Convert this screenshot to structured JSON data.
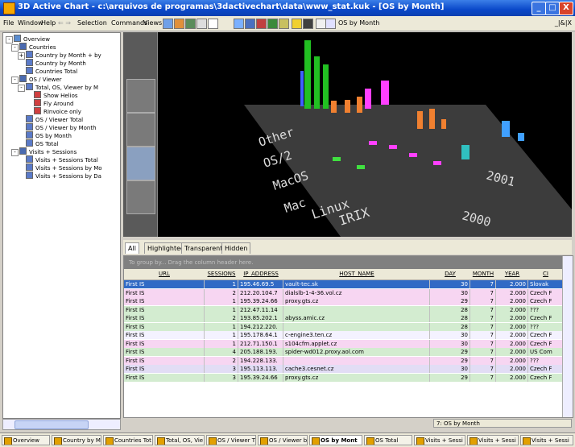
{
  "window": {
    "title": "3D Active Chart - c:\\arquivos de programas\\3dactivechart\\data\\www_stat.kuk - [OS by Month]",
    "minimize": "_",
    "maximize": "□",
    "close": "X"
  },
  "menu": {
    "items": [
      "File",
      "Window",
      "Help",
      "Selection",
      "Commands",
      "Views"
    ],
    "view_name": "OS by Month",
    "mdi_controls": "_|&|X"
  },
  "tree": [
    {
      "label": "Overview",
      "level": 0
    },
    {
      "label": "Countries",
      "level": 1
    },
    {
      "label": "Country by Month + by",
      "level": 2
    },
    {
      "label": "Country by Month",
      "level": 2
    },
    {
      "label": "Countries Total",
      "level": 2
    },
    {
      "label": "OS / Viewer",
      "level": 1
    },
    {
      "label": "Total, OS, Viewer by M",
      "level": 2
    },
    {
      "label": "Show Helios",
      "level": 3
    },
    {
      "label": "Fly Around",
      "level": 3
    },
    {
      "label": "RInvoice only",
      "level": 3
    },
    {
      "label": "OS / Viewer Total",
      "level": 2
    },
    {
      "label": "OS / Viewer by Month",
      "level": 2
    },
    {
      "label": "OS by Month",
      "level": 2
    },
    {
      "label": "OS Total",
      "level": 2
    },
    {
      "label": "Visits + Sessions",
      "level": 1
    },
    {
      "label": "Visits + Sessions Total",
      "level": 2
    },
    {
      "label": "Visits + Sessions by Mo",
      "level": 2
    },
    {
      "label": "Visits + Sessions by Da",
      "level": 2
    }
  ],
  "chart": {
    "os_labels": [
      "Other",
      "OS/2",
      "MacOS",
      "Mac",
      "Linux",
      "IRIX"
    ],
    "year_labels": [
      "2001",
      "2000"
    ],
    "side_tools": [
      "zoom",
      "pan",
      "rotate",
      "fit"
    ]
  },
  "tabs": [
    "All",
    "Highlighted",
    "Transparent",
    "Hidden"
  ],
  "grid": {
    "group_hint": "To group by... Drag the column header here.",
    "columns": [
      "URL",
      "SESSIONS",
      "IP_ADDRESS",
      "HOST_NAME",
      "DAY",
      "MONTH",
      "YEAR",
      "CI"
    ],
    "rows": [
      {
        "url": "First IS",
        "sessions": "1",
        "ip": "195.46.69.5",
        "host": "vault-tec.sk",
        "day": "30",
        "month": "7",
        "year": "2.000",
        "ci": "Slovak",
        "color": "#316ac5"
      },
      {
        "url": "First IS",
        "sessions": "2",
        "ip": "212.20.104.7",
        "host": "dialslb-1-4-36.vol.cz",
        "day": "30",
        "month": "7",
        "year": "2.000",
        "ci": "Czech F",
        "color": "#f7d6f2"
      },
      {
        "url": "First IS",
        "sessions": "1",
        "ip": "195.39.24.66",
        "host": "proxy.gts.cz",
        "day": "29",
        "month": "7",
        "year": "2.000",
        "ci": "Czech F",
        "color": "#f7d6f2"
      },
      {
        "url": "First IS",
        "sessions": "1",
        "ip": "212.47.11.14",
        "host": "",
        "day": "28",
        "month": "7",
        "year": "2.000",
        "ci": "???",
        "color": "#d3ecd0"
      },
      {
        "url": "First IS",
        "sessions": "2",
        "ip": "193.85.202.1",
        "host": "abyss.amic.cz",
        "day": "28",
        "month": "7",
        "year": "2.000",
        "ci": "Czech F",
        "color": "#d3ecd0"
      },
      {
        "url": "First IS",
        "sessions": "1",
        "ip": "194.212.220.",
        "host": "",
        "day": "28",
        "month": "7",
        "year": "2.000",
        "ci": "???",
        "color": "#d3ecd0"
      },
      {
        "url": "First IS",
        "sessions": "1",
        "ip": "195.178.64.1",
        "host": "c-engine3.ten.cz",
        "day": "30",
        "month": "7",
        "year": "2.000",
        "ci": "Czech F",
        "color": "#f4f2ff"
      },
      {
        "url": "First IS",
        "sessions": "1",
        "ip": "212.71.150.1",
        "host": "s104cfm.applet.cz",
        "day": "30",
        "month": "7",
        "year": "2.000",
        "ci": "Czech F",
        "color": "#f7d6f2"
      },
      {
        "url": "First IS",
        "sessions": "4",
        "ip": "205.188.193.",
        "host": "spider-wd012.proxy.aol.com",
        "day": "29",
        "month": "7",
        "year": "2.000",
        "ci": "US Com",
        "color": "#d3ecd0"
      },
      {
        "url": "First IS",
        "sessions": "2",
        "ip": "194.228.133.",
        "host": "",
        "day": "29",
        "month": "7",
        "year": "2.000",
        "ci": "???",
        "color": "#f7d6f2"
      },
      {
        "url": "First IS",
        "sessions": "3",
        "ip": "195.113.113.",
        "host": "cache3.cesnet.cz",
        "day": "30",
        "month": "7",
        "year": "2.000",
        "ci": "Czech F",
        "color": "#e2ddf5"
      },
      {
        "url": "First IS",
        "sessions": "3",
        "ip": "195.39.24.66",
        "host": "proxy.gts.cz",
        "day": "29",
        "month": "7",
        "year": "2.000",
        "ci": "Czech F",
        "color": "#d3ecd0"
      }
    ]
  },
  "status": {
    "text": "7: OS by Month"
  },
  "taskbar": [
    "Overview",
    "Country by Mo",
    "Countries Tot",
    "Total, OS, Vie",
    "OS / Viewer T",
    "OS / Viewer b",
    "OS by Mont",
    "OS Total",
    "Visits + Sessi",
    "Visits + Sessi",
    "Visits + Sessi"
  ]
}
